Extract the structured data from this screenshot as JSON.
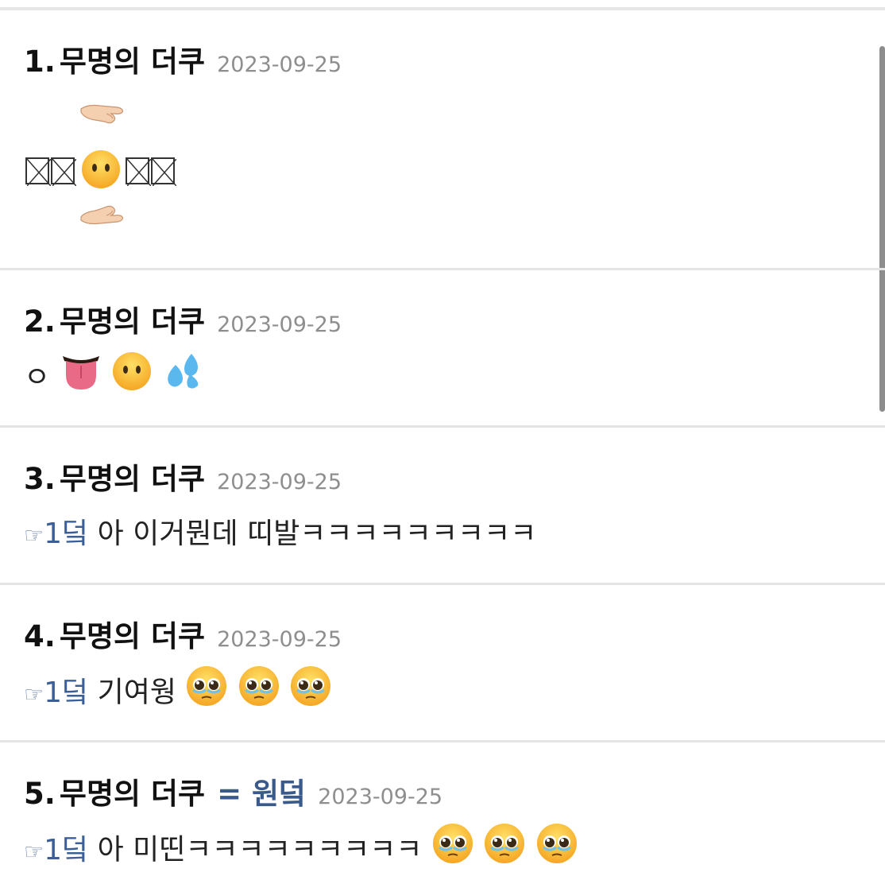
{
  "comments": [
    {
      "number": "1.",
      "author": "무명의 더쿠",
      "date": "2023-09-25",
      "body_art": {
        "top": "🫳",
        "middle_boxes_left": "⊠⊠",
        "middle_face": "😶",
        "middle_boxes_right": "⊠⊠",
        "bottom": "🫴"
      }
    },
    {
      "number": "2.",
      "author": "무명의 더쿠",
      "date": "2023-09-25",
      "body_prefix": "ㅇ",
      "emojis": [
        "👅",
        "😶",
        "💦"
      ]
    },
    {
      "number": "3.",
      "author": "무명의 더쿠",
      "date": "2023-09-25",
      "reply_pointer": "☞",
      "reply_ref": "1덬",
      "body_text": " 아 이거뭔데 띠발ㅋㅋㅋㅋㅋㅋㅋㅋㅋ"
    },
    {
      "number": "4.",
      "author": "무명의 더쿠",
      "date": "2023-09-25",
      "reply_pointer": "☞",
      "reply_ref": "1덬",
      "body_text": " 기여웡",
      "emojis": [
        "🥹",
        "🥹",
        "🥹"
      ]
    },
    {
      "number": "5.",
      "author": "무명의 더쿠",
      "author_tag": "= 원덬",
      "date": "2023-09-25",
      "reply_pointer": "☞",
      "reply_ref": "1덬",
      "body_text": " 아 미띤ㅋㅋㅋㅋㅋㅋㅋㅋㅋ ",
      "emojis": [
        "🥹",
        "🥹",
        "🥹"
      ]
    }
  ],
  "icons": {
    "face_without_mouth": "face-without-mouth-icon",
    "tongue": "tongue-icon",
    "sweat_drops": "sweat-droplets-icon",
    "pleading_face": "face-holding-back-tears-icon",
    "palm_down_hand": "palm-down-hand-icon",
    "palm_up_hand": "palm-up-hand-icon"
  },
  "colors": {
    "reply_ref": "#3d5f97",
    "date": "#8e8e8e",
    "divider": "#e4e4e4",
    "author_tag": "#3a5a8c"
  }
}
